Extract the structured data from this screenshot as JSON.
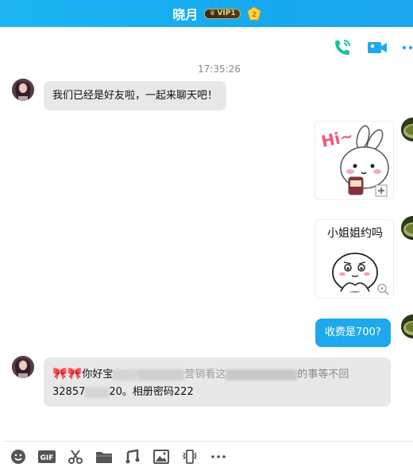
{
  "header": {
    "title": "晓月",
    "vip_label": "VIP1"
  },
  "chat": {
    "timestamp": "17:35:26",
    "msg1": "我们已经是好友啦，一起来聊天吧！",
    "sticker2_text": "小姐姐约吗",
    "msg_fee": "收费是700?",
    "msg_last_line1_start": "你好宝",
    "msg_last_line1_mid1": "营销",
    "msg_last_line1_mid2": "看这",
    "msg_last_line1_end": "的事等不回",
    "msg_last_line2_start": "32857",
    "msg_last_line2_end": "20。相册密码222"
  },
  "icons": {
    "phone": "phone-icon",
    "video": "video-call-icon",
    "more": "more-icon"
  },
  "colors": {
    "accent": "#1ea9ef",
    "phone_green": "#17c1a0",
    "bubble_gray": "#e8e8e8"
  }
}
